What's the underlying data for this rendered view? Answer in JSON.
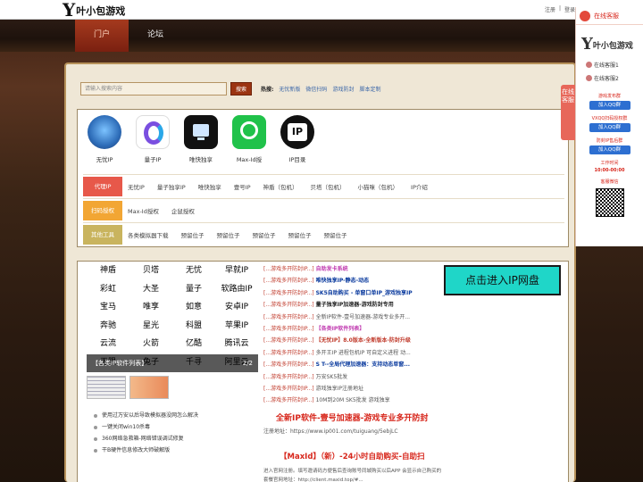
{
  "topbar": {
    "logo_mark": "Y",
    "logo_text": "叶小包游戏",
    "links": [
      "注册",
      "|",
      "登录"
    ]
  },
  "nav": {
    "items": [
      "门户",
      "论坛"
    ]
  },
  "search": {
    "placeholder": "请输入搜索内容",
    "button": "搜索",
    "hot_label": "热搜:",
    "hot_links": [
      "无忧新版",
      "微信扫码",
      "游戏防封",
      "脚本定制"
    ]
  },
  "apps": [
    {
      "label": "无忧IP",
      "color": "#3c85c8"
    },
    {
      "label": "量子IP",
      "color": "#7a4fe0"
    },
    {
      "label": "唯快独享",
      "color": "#111111"
    },
    {
      "label": "Max-Id授",
      "color": "#20c24a"
    },
    {
      "label": "IP目录",
      "color": "#111111"
    }
  ],
  "categories": [
    {
      "tag": "代理IP",
      "color": "#e7584a",
      "links": [
        "无忧IP",
        "量子独享IP",
        "唯快独享",
        "壹号IP",
        "神盾（包机）",
        "贝塔（包机）",
        "小猫咪（包机）",
        "IP介绍"
      ]
    },
    {
      "tag": "扫码授权",
      "color": "#f2a634",
      "links": [
        "Max-Id授权",
        "企鼠授权"
      ]
    },
    {
      "tag": "其他工具",
      "color": "#c9b45e",
      "links": [
        "各类模拟器下载",
        "预留位子",
        "预留位子",
        "预留位子",
        "预留位子",
        "预留位子"
      ]
    }
  ],
  "slider": {
    "grid": [
      "神盾",
      "贝塔",
      "无忧",
      "早就IP",
      "彩虹",
      "大圣",
      "量子",
      "软路由IP",
      "宝马",
      "唯享",
      "如意",
      "安卓IP",
      "奔驰",
      "星光",
      "科盟",
      "苹果IP",
      "云流",
      "火箭",
      "亿酷",
      "腾讯云",
      "无限",
      "兔子",
      "千寻",
      "阿里云"
    ],
    "caption": "【各类IP软件列表】",
    "page": "2/2"
  },
  "news_left": [
    "使用过万安以后导致模拟器没网怎么解决",
    "一键关闭win10杀毒",
    "360网络急救箱-网络错误调试修复",
    "干B硬件信息修改大师破解版"
  ],
  "news_mid_prefix": "[...游戏多开防封IP...]",
  "news_mid": [
    {
      "title": "自助发卡系统",
      "color": "#c03ab0"
    },
    {
      "title": "唯快独享IP-静态-动态",
      "color": "#0a3a9e"
    },
    {
      "title": "SK5自助购买 - 单窗口单IP_游戏独享IP",
      "color": "#0a3a9e"
    },
    {
      "title": "量子独享IP加速器-游戏防封专用",
      "color": "#222222"
    },
    {
      "title": "全新IP软件-壹号加速器-游戏专业多开...",
      "color": "#555555"
    },
    {
      "title": "【各类IP软件列表】",
      "color": "#c03ab0"
    },
    {
      "title": "【无忧IP】8.0版本-全新版本-防封升级",
      "color": "#c03a2b"
    },
    {
      "title": "多开王IP 进程包机IP 可自定义进程 动...",
      "color": "#555555"
    },
    {
      "title": "S T--全局代理加速器：支持动态单窗...",
      "color": "#0a3a9e"
    },
    {
      "title": "万安SK5批发",
      "color": "#555555"
    },
    {
      "title": "游戏独享IP注册地址",
      "color": "#555555"
    },
    {
      "title": "10M到20M SK5批发 游戏独享",
      "color": "#555555"
    }
  ],
  "highlight": {
    "big_red": "全新IP软件-壹号加速器-游戏专业多开防封",
    "register": "注册地址：https://www.ip001.com/tuiguang/5ebjLC",
    "max_title": "【MaxId】（新）-24小时自助购买-自助扫",
    "max_desc": "进入官网注册。填写邀请码方便售后查询账号同城购买以后APP 会显示自己购买的套餐官网地址：http://client.maxid.top/#..."
  },
  "ip_banner": "点击进入IP网盘",
  "service": {
    "head": "在线客服",
    "tab": "在线客服",
    "logo_mark": "Y",
    "logo_text": "叶小包游戏",
    "kf1": "在线客服1",
    "kf2": "在线客服2",
    "box1_title": "游戏发布群",
    "box2_title": "VXQQ扫码授权群",
    "box3_title": "防封IP售后群",
    "join": "加入QQ群",
    "work_label": "工作时间",
    "work_time": "10:00-00:00",
    "wechat_label": "客服微信"
  }
}
